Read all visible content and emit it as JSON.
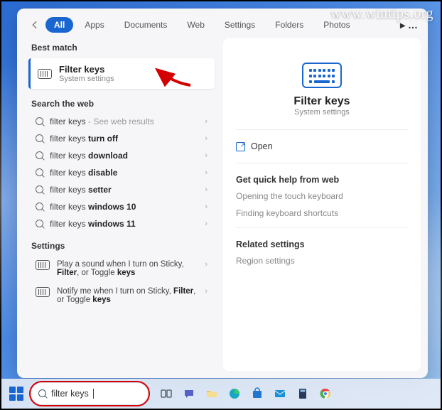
{
  "watermark": "www.wintips.org",
  "tabs": {
    "active": "All",
    "items": [
      "All",
      "Apps",
      "Documents",
      "Web",
      "Settings",
      "Folders",
      "Photos"
    ]
  },
  "best_match": {
    "label": "Best match",
    "title": "Filter keys",
    "subtitle": "System settings"
  },
  "web": {
    "label": "Search the web",
    "rows": [
      {
        "prefix": "filter keys",
        "suffix": " - See web results",
        "bold": ""
      },
      {
        "prefix": "filter keys ",
        "suffix": "",
        "bold": "turn off"
      },
      {
        "prefix": "filter keys ",
        "suffix": "",
        "bold": "download"
      },
      {
        "prefix": "filter keys ",
        "suffix": "",
        "bold": "disable"
      },
      {
        "prefix": "filter keys ",
        "suffix": "",
        "bold": "setter"
      },
      {
        "prefix": "filter keys ",
        "suffix": "",
        "bold": "windows 10"
      },
      {
        "prefix": "filter keys ",
        "suffix": "",
        "bold": "windows 11"
      }
    ]
  },
  "settings": {
    "label": "Settings",
    "rows": [
      {
        "pre": "Play a sound when I turn on Sticky, ",
        "bold": "Filter",
        "post": ", or Toggle ",
        "bold2": "keys"
      },
      {
        "pre": "Notify me when I turn on Sticky, ",
        "bold": "Filter",
        "post": ", or Toggle ",
        "bold2": "keys"
      }
    ]
  },
  "detail": {
    "title": "Filter keys",
    "subtitle": "System settings",
    "open": "Open",
    "quick_label": "Get quick help from web",
    "quick_links": [
      "Opening the touch keyboard",
      "Finding keyboard shortcuts"
    ],
    "related_label": "Related settings",
    "related_links": [
      "Region settings"
    ]
  },
  "taskbar": {
    "search_value": "filter keys",
    "icons": [
      "task-view",
      "chat",
      "explorer",
      "edge",
      "store",
      "mail",
      "calculator",
      "chrome"
    ]
  },
  "colors": {
    "accent": "#1a66d1",
    "danger": "#d40000"
  }
}
